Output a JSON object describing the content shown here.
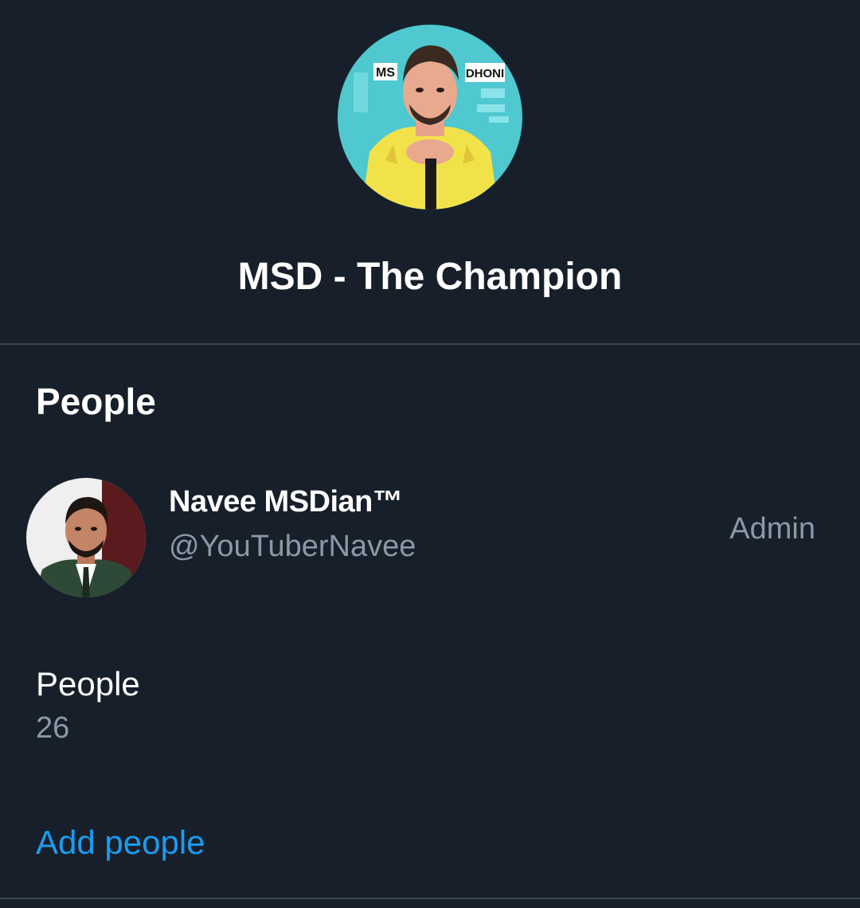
{
  "group": {
    "title": "MSD - The Champion",
    "avatar_text_left": "MS",
    "avatar_text_right": "DHONI",
    "avatar_bg": "#4fc8d0",
    "jersey_color": "#f2e24a"
  },
  "people_section": {
    "title": "People",
    "members": [
      {
        "name": "Navee MSDian™",
        "handle": "@YouTuberNavee",
        "role": "Admin"
      }
    ],
    "count_label": "People",
    "count_value": "26",
    "add_label": "Add people"
  },
  "colors": {
    "background": "#17202a",
    "secondary_text": "#8b98a5",
    "link": "#1d9bf0",
    "divider": "#38444d"
  }
}
